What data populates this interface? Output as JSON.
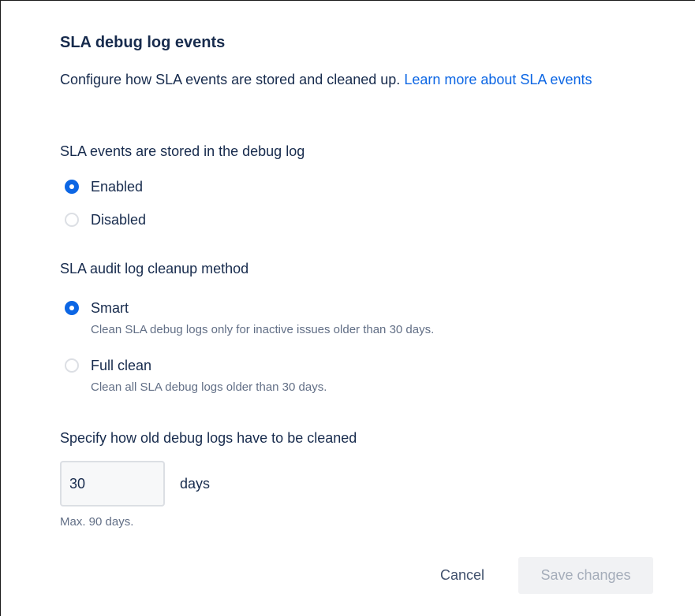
{
  "page": {
    "title": "SLA debug log events",
    "description": "Configure how SLA events are stored and cleaned up.",
    "learn_more_link": "Learn more about SLA events"
  },
  "storage": {
    "label": "SLA events are stored in the debug log",
    "options": [
      {
        "label": "Enabled",
        "selected": true
      },
      {
        "label": "Disabled",
        "selected": false
      }
    ]
  },
  "cleanup": {
    "label": "SLA audit log cleanup method",
    "options": [
      {
        "label": "Smart",
        "hint": "Clean SLA debug logs only for inactive issues older than 30 days.",
        "selected": true
      },
      {
        "label": "Full clean",
        "hint": "Clean all SLA debug logs older than 30 days.",
        "selected": false
      }
    ]
  },
  "age": {
    "label": "Specify how old debug logs have to be cleaned",
    "value": "30",
    "unit": "days",
    "hint": "Max. 90 days."
  },
  "actions": {
    "cancel_label": "Cancel",
    "save_label": "Save changes",
    "save_disabled": true
  },
  "colors": {
    "accent": "#0c66e4",
    "text": "#172b4d",
    "subtle_text": "#626f86",
    "disabled_bg": "#f1f2f4"
  }
}
